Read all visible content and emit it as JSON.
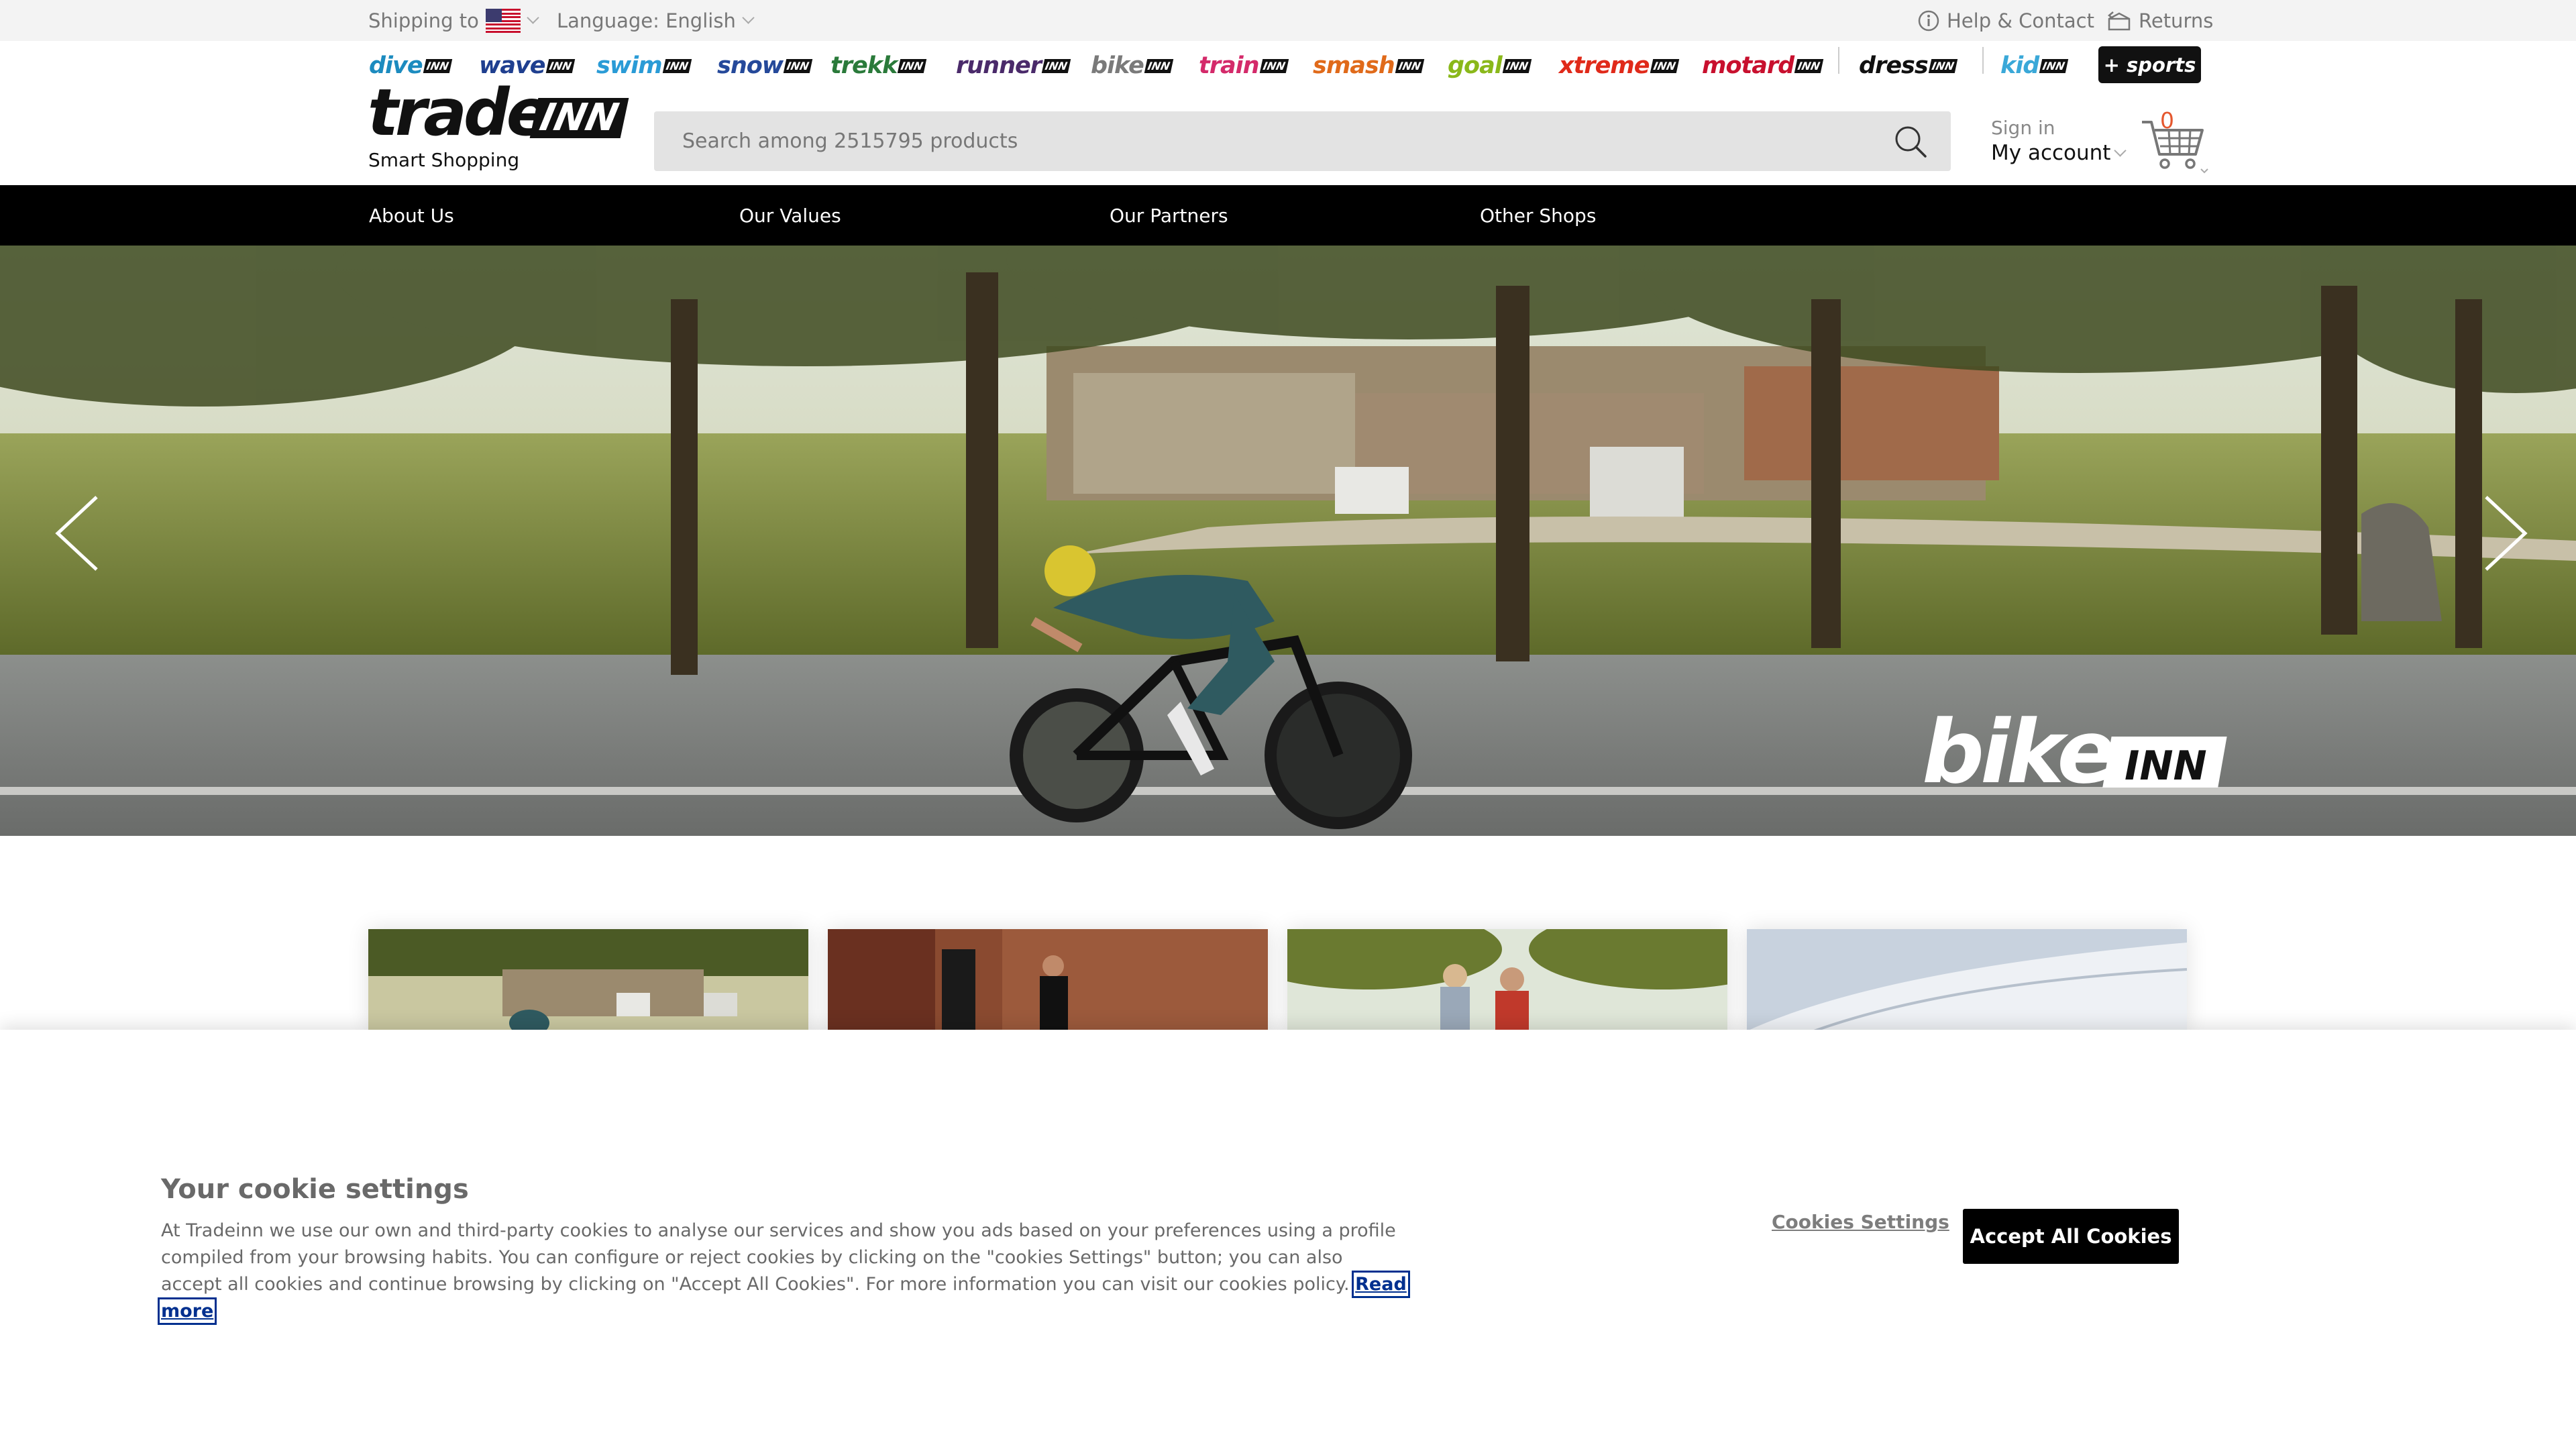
{
  "topbar": {
    "shipping_label": "Shipping to",
    "language_label": "Language: English",
    "help_label": "Help & Contact",
    "returns_label": "Returns"
  },
  "shops": [
    {
      "name": "dive",
      "suffix": "INN",
      "color": "#1c8bbf"
    },
    {
      "name": "wave",
      "suffix": "INN",
      "color": "#1f3f8f"
    },
    {
      "name": "swim",
      "suffix": "INN",
      "color": "#2a9bd6"
    },
    {
      "name": "snow",
      "suffix": "INN",
      "color": "#25499a"
    },
    {
      "name": "trekk",
      "suffix": "INN",
      "color": "#2a7a3a"
    },
    {
      "name": "runner",
      "suffix": "INN",
      "color": "#4a2a6a"
    },
    {
      "name": "bike",
      "suffix": "INN",
      "color": "#7a7a7a"
    },
    {
      "name": "train",
      "suffix": "INN",
      "color": "#d42a6a"
    },
    {
      "name": "smash",
      "suffix": "INN",
      "color": "#e06a1a"
    },
    {
      "name": "goal",
      "suffix": "INN",
      "color": "#8ab81a"
    },
    {
      "name": "xtreme",
      "suffix": "INN",
      "color": "#e02a1a"
    },
    {
      "name": "motard",
      "suffix": "INN",
      "color": "#c8102e"
    },
    {
      "name": "dress",
      "suffix": "INN",
      "color": "#111111"
    },
    {
      "name": "kid",
      "suffix": "INN",
      "color": "#3aa8d8"
    }
  ],
  "sports_button": "+ sports",
  "logo": {
    "word": "trade",
    "inn": "INN",
    "tagline": "Smart Shopping"
  },
  "search": {
    "placeholder": "Search among 2515795 products"
  },
  "account": {
    "signin": "Sign in",
    "my_account": "My account",
    "cart_count": "0"
  },
  "nav": [
    "About Us",
    "Our Values",
    "Our Partners",
    "Other Shops"
  ],
  "hero": {
    "brand": "bike",
    "brand_suffix": "INN"
  },
  "cookie": {
    "title": "Your cookie settings",
    "text": "At Tradeinn we use our own and third-party cookies to analyse our services and show you ads based on your preferences using a profile compiled from your browsing habits. You can configure or reject cookies by clicking on the \"cookies Settings\" button; you can also accept all cookies and continue browsing by clicking on \"Accept All Cookies\". For more information you can visit our cookies policy.",
    "read_more": "Read more",
    "settings_button": "Cookies Settings",
    "accept_button": "Accept All Cookies"
  },
  "colors": {
    "accent": "#000000",
    "cart_count": "#e4572e",
    "topbar_bg": "#f3f3f3"
  }
}
